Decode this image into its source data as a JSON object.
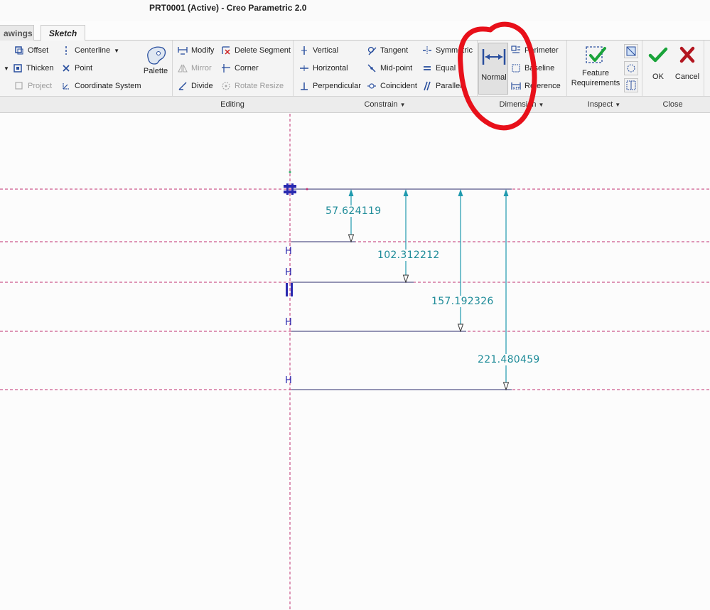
{
  "window": {
    "title": "PRT0001 (Active) - Creo Parametric 2.0"
  },
  "tabs": [
    {
      "label": "awings"
    },
    {
      "label": "Sketch"
    }
  ],
  "ribbon": {
    "sketching": {
      "offset": "Offset",
      "thicken": "Thicken",
      "project": "Project",
      "centerline": "Centerline",
      "point": "Point",
      "coordinate_system": "Coordinate System",
      "palette": "Palette"
    },
    "editing": {
      "modify": "Modify",
      "delete_segment": "Delete Segment",
      "mirror": "Mirror",
      "corner": "Corner",
      "divide": "Divide",
      "rotate_resize": "Rotate Resize",
      "group_label": "Editing"
    },
    "constrain": {
      "vertical": "Vertical",
      "horizontal": "Horizontal",
      "perpendicular": "Perpendicular",
      "tangent": "Tangent",
      "mid_point": "Mid-point",
      "coincident": "Coincident",
      "symmetric": "Symmetric",
      "equal": "Equal",
      "parallel": "Parallel",
      "group_label": "Constrain"
    },
    "dimension": {
      "normal": "Normal",
      "perimeter": "Perimeter",
      "baseline": "Baseline",
      "reference": "Reference",
      "group_label": "Dimension"
    },
    "inspect": {
      "feature_requirements_line1": "Feature",
      "feature_requirements_line2": "Requirements",
      "group_label": "Inspect"
    },
    "close": {
      "ok": "OK",
      "cancel": "Cancel",
      "group_label": "Close"
    }
  },
  "canvas": {
    "dimensions": [
      {
        "value": "57.624119"
      },
      {
        "value": "102.312212"
      },
      {
        "value": "157.192326"
      },
      {
        "value": "221.480459"
      }
    ],
    "constraint_h": "H",
    "colors": {
      "dimension": "#1f8c99",
      "reference_line": "#c0306f",
      "geometry": "#555588",
      "constraint": "#2a2ab0",
      "annotation": "#e8101a"
    }
  }
}
